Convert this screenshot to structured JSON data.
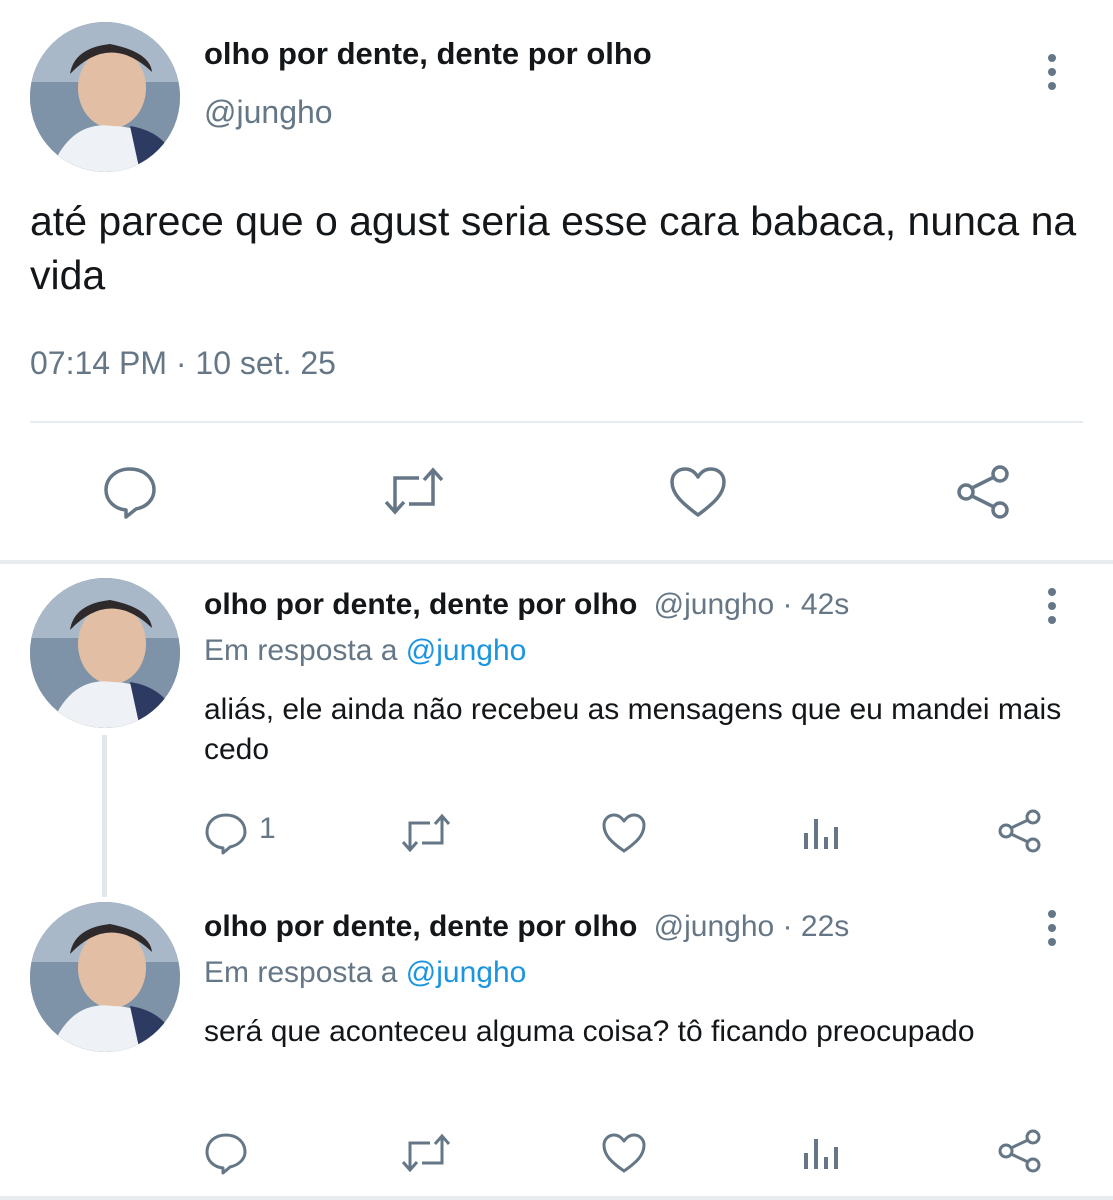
{
  "main_tweet": {
    "display_name": "olho por dente, dente por olho",
    "handle": "@jungho",
    "text": "até parece que o agust seria esse cara babaca, nunca na vida",
    "time": "07:14 PM",
    "date_sep": "·",
    "date": "10 set. 25"
  },
  "replies": [
    {
      "display_name": "olho por dente, dente por olho",
      "handle": "@jungho",
      "time_sep": "·",
      "time": "42s",
      "in_reply_prefix": "Em resposta a",
      "in_reply_handle": "@jungho",
      "text": "aliás, ele ainda não recebeu as mensagens que eu mandei mais cedo",
      "reply_count": "1"
    },
    {
      "display_name": "olho por dente, dente por olho",
      "handle": "@jungho",
      "time_sep": "·",
      "time": "22s",
      "in_reply_prefix": "Em resposta a",
      "in_reply_handle": "@jungho",
      "text": "será que aconteceu alguma coisa? tô ficando preocupado",
      "reply_count": ""
    }
  ],
  "icons": [
    "reply-icon",
    "retweet-icon",
    "like-icon",
    "share-icon",
    "analytics-icon",
    "more-icon"
  ],
  "colors": {
    "text": "#14171a",
    "muted": "#657786",
    "link": "#1b95e0",
    "icon": "#657786"
  }
}
